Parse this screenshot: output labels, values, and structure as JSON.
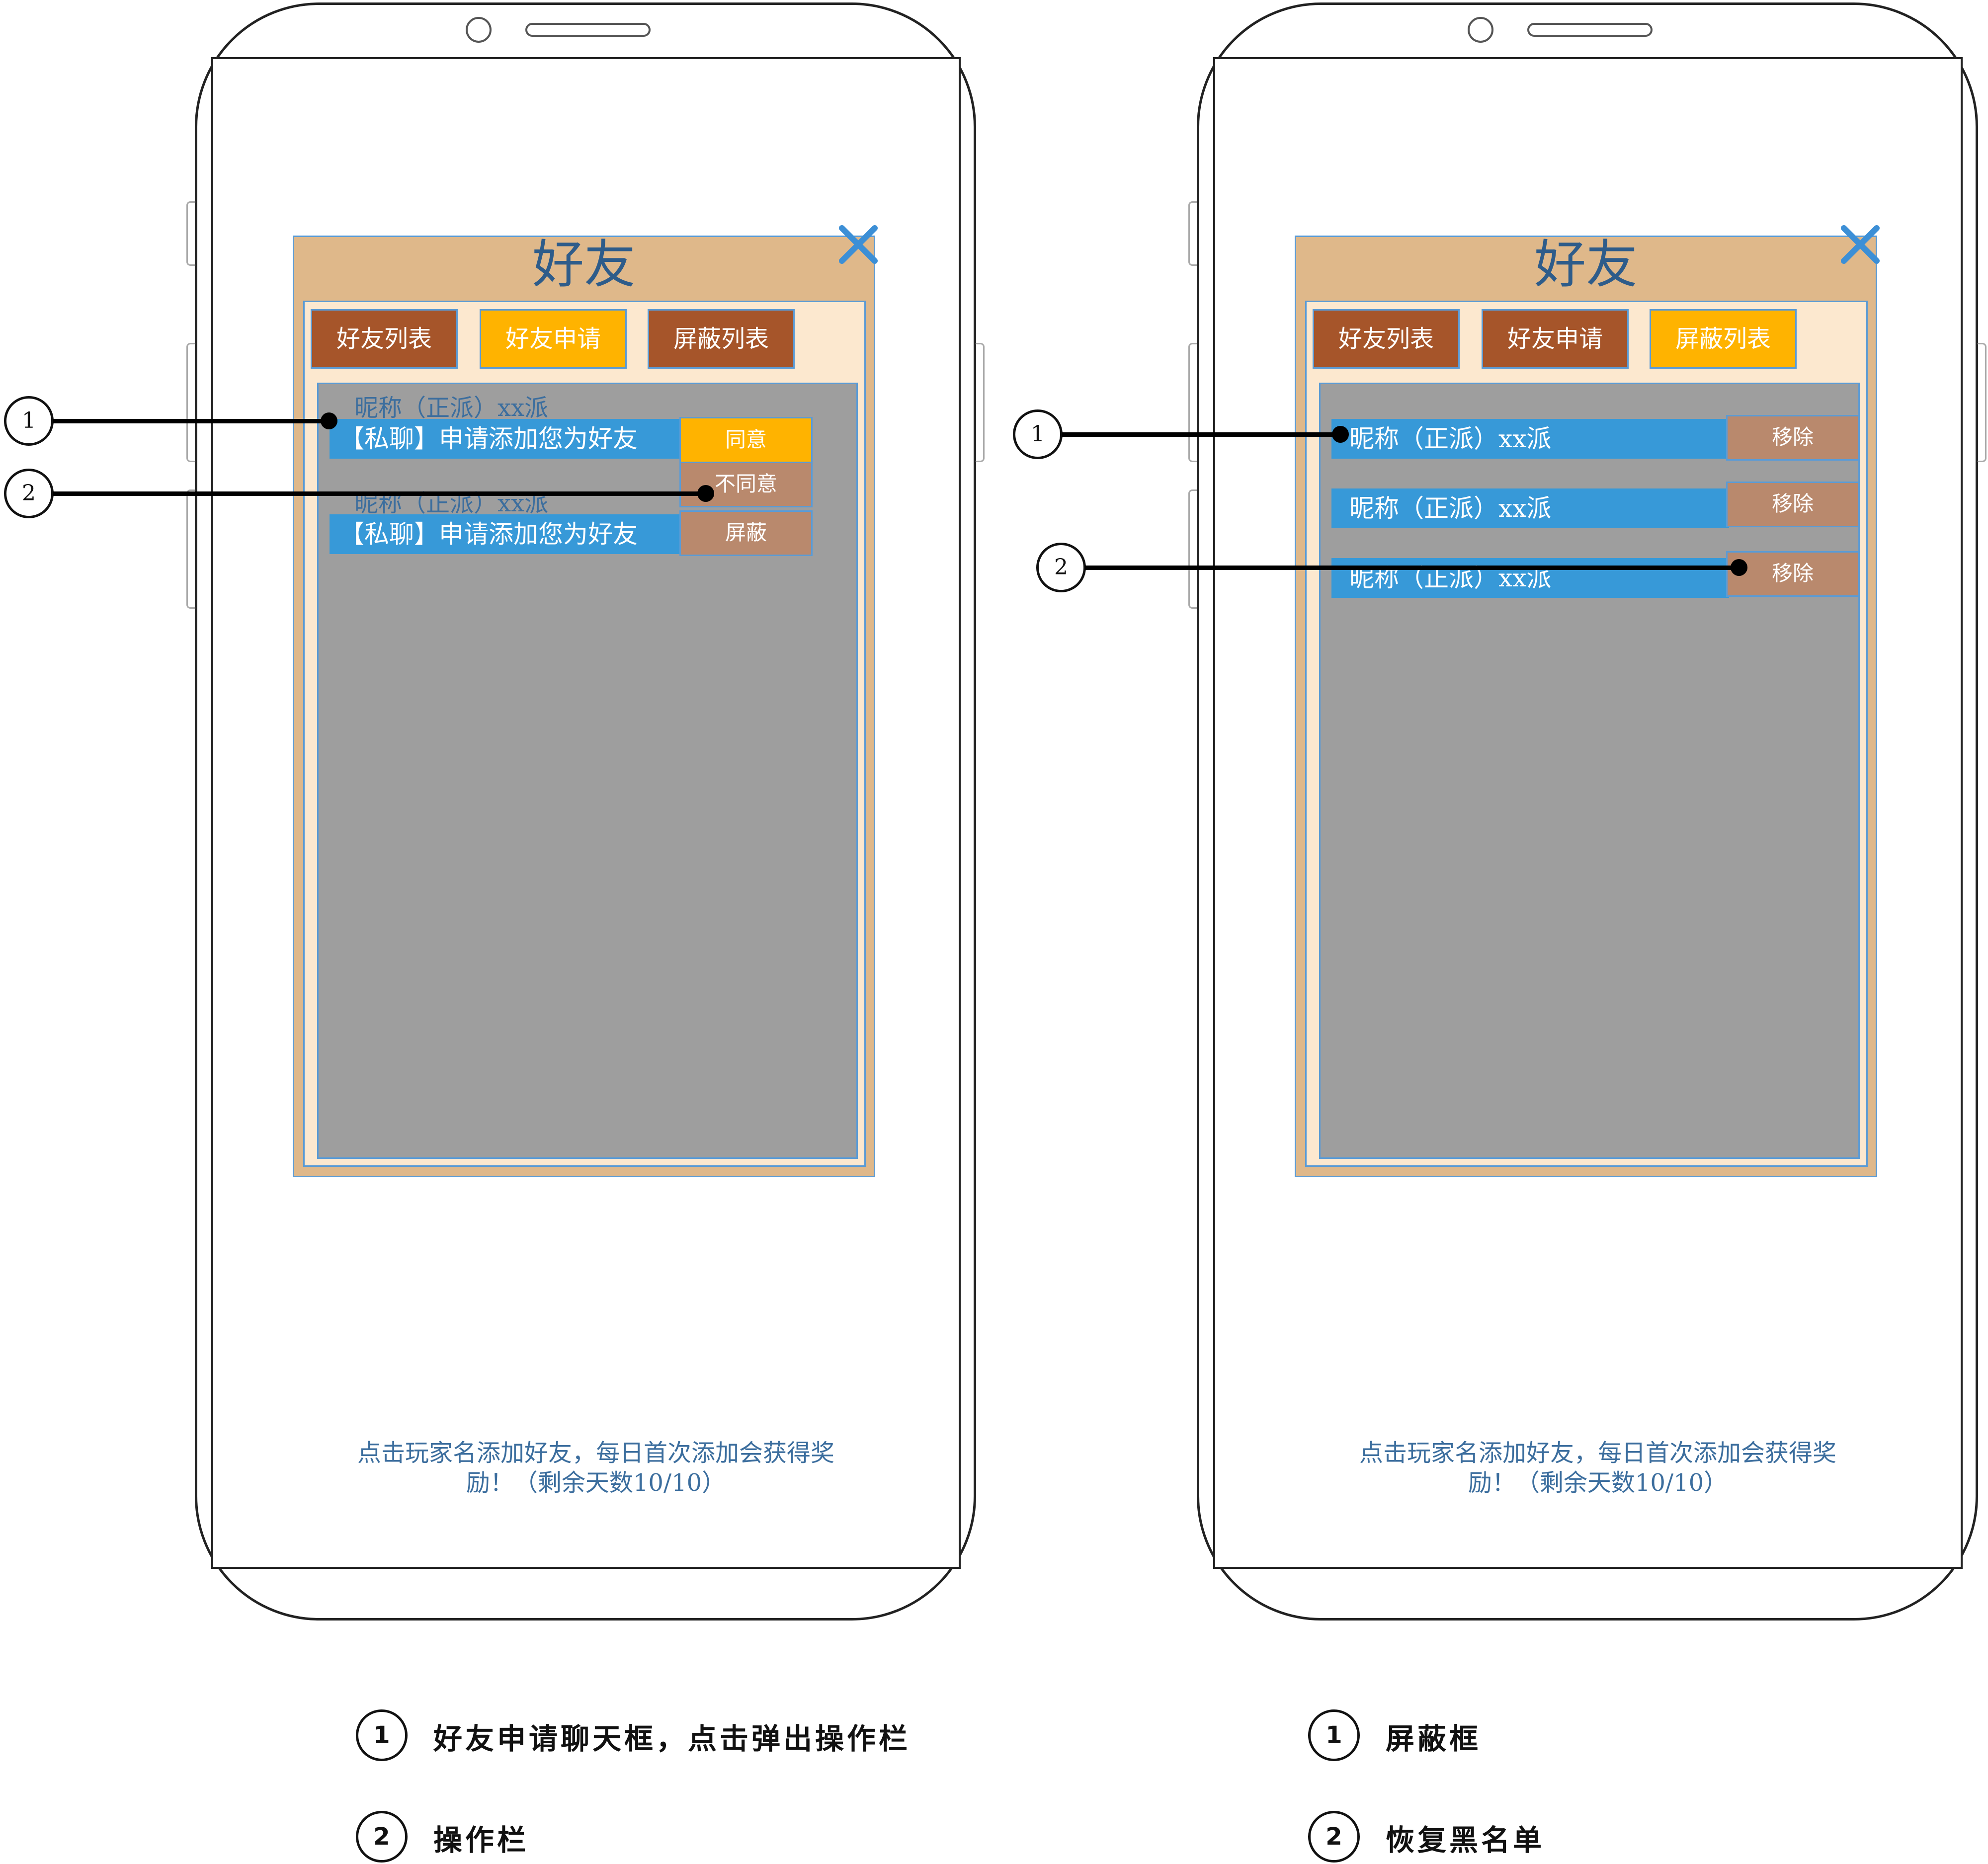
{
  "left_screen": {
    "dialog_title": "好友",
    "tabs": [
      {
        "label": "好友列表",
        "active": false
      },
      {
        "label": "好友申请",
        "active": true
      },
      {
        "label": "屏蔽列表",
        "active": false
      }
    ],
    "requests": [
      {
        "nickname": "昵称（正派）xx派",
        "message": "【私聊】申请添加您为好友"
      },
      {
        "nickname": "昵称（正派）xx派",
        "message": "【私聊】申请添加您为好友"
      }
    ],
    "actions": {
      "agree": "同意",
      "disagree": "不同意",
      "block": "屏蔽"
    },
    "footer_note_line1": "点击玩家名添加好友，每日首次添加会获得奖",
    "footer_note_line2": "励！（剩余天数10/10）",
    "callouts": [
      "1",
      "2"
    ]
  },
  "right_screen": {
    "dialog_title": "好友",
    "tabs": [
      {
        "label": "好友列表",
        "active": false
      },
      {
        "label": "好友申请",
        "active": false
      },
      {
        "label": "屏蔽列表",
        "active": true
      }
    ],
    "blocked": [
      {
        "nickname": "昵称（正派）xx派",
        "remove_label": "移除"
      },
      {
        "nickname": "昵称（正派）xx派",
        "remove_label": "移除"
      },
      {
        "nickname": "昵称（正派）xx派",
        "remove_label": "移除"
      }
    ],
    "footer_note_line1": "点击玩家名添加好友，每日首次添加会获得奖",
    "footer_note_line2": "励！（剩余天数10/10）",
    "callouts": [
      "1",
      "2"
    ]
  },
  "legend_left": [
    {
      "num": "1",
      "text": "好友申请聊天框，点击弹出操作栏"
    },
    {
      "num": "2",
      "text": "操作栏"
    }
  ],
  "legend_right": [
    {
      "num": "1",
      "text": "屏蔽框"
    },
    {
      "num": "2",
      "text": "恢复黑名单"
    }
  ],
  "colors": {
    "dialog_bg": "#dfb88a",
    "inner_bg": "#fce8cf",
    "tab_inactive": "#a6552a",
    "tab_active": "#ffb300",
    "list_bg": "#9e9e9e",
    "message_bar": "#3799d8",
    "action_other": "#b9896d",
    "accent_blue": "#3c8fd6"
  },
  "icons": {
    "close": "close-icon"
  }
}
